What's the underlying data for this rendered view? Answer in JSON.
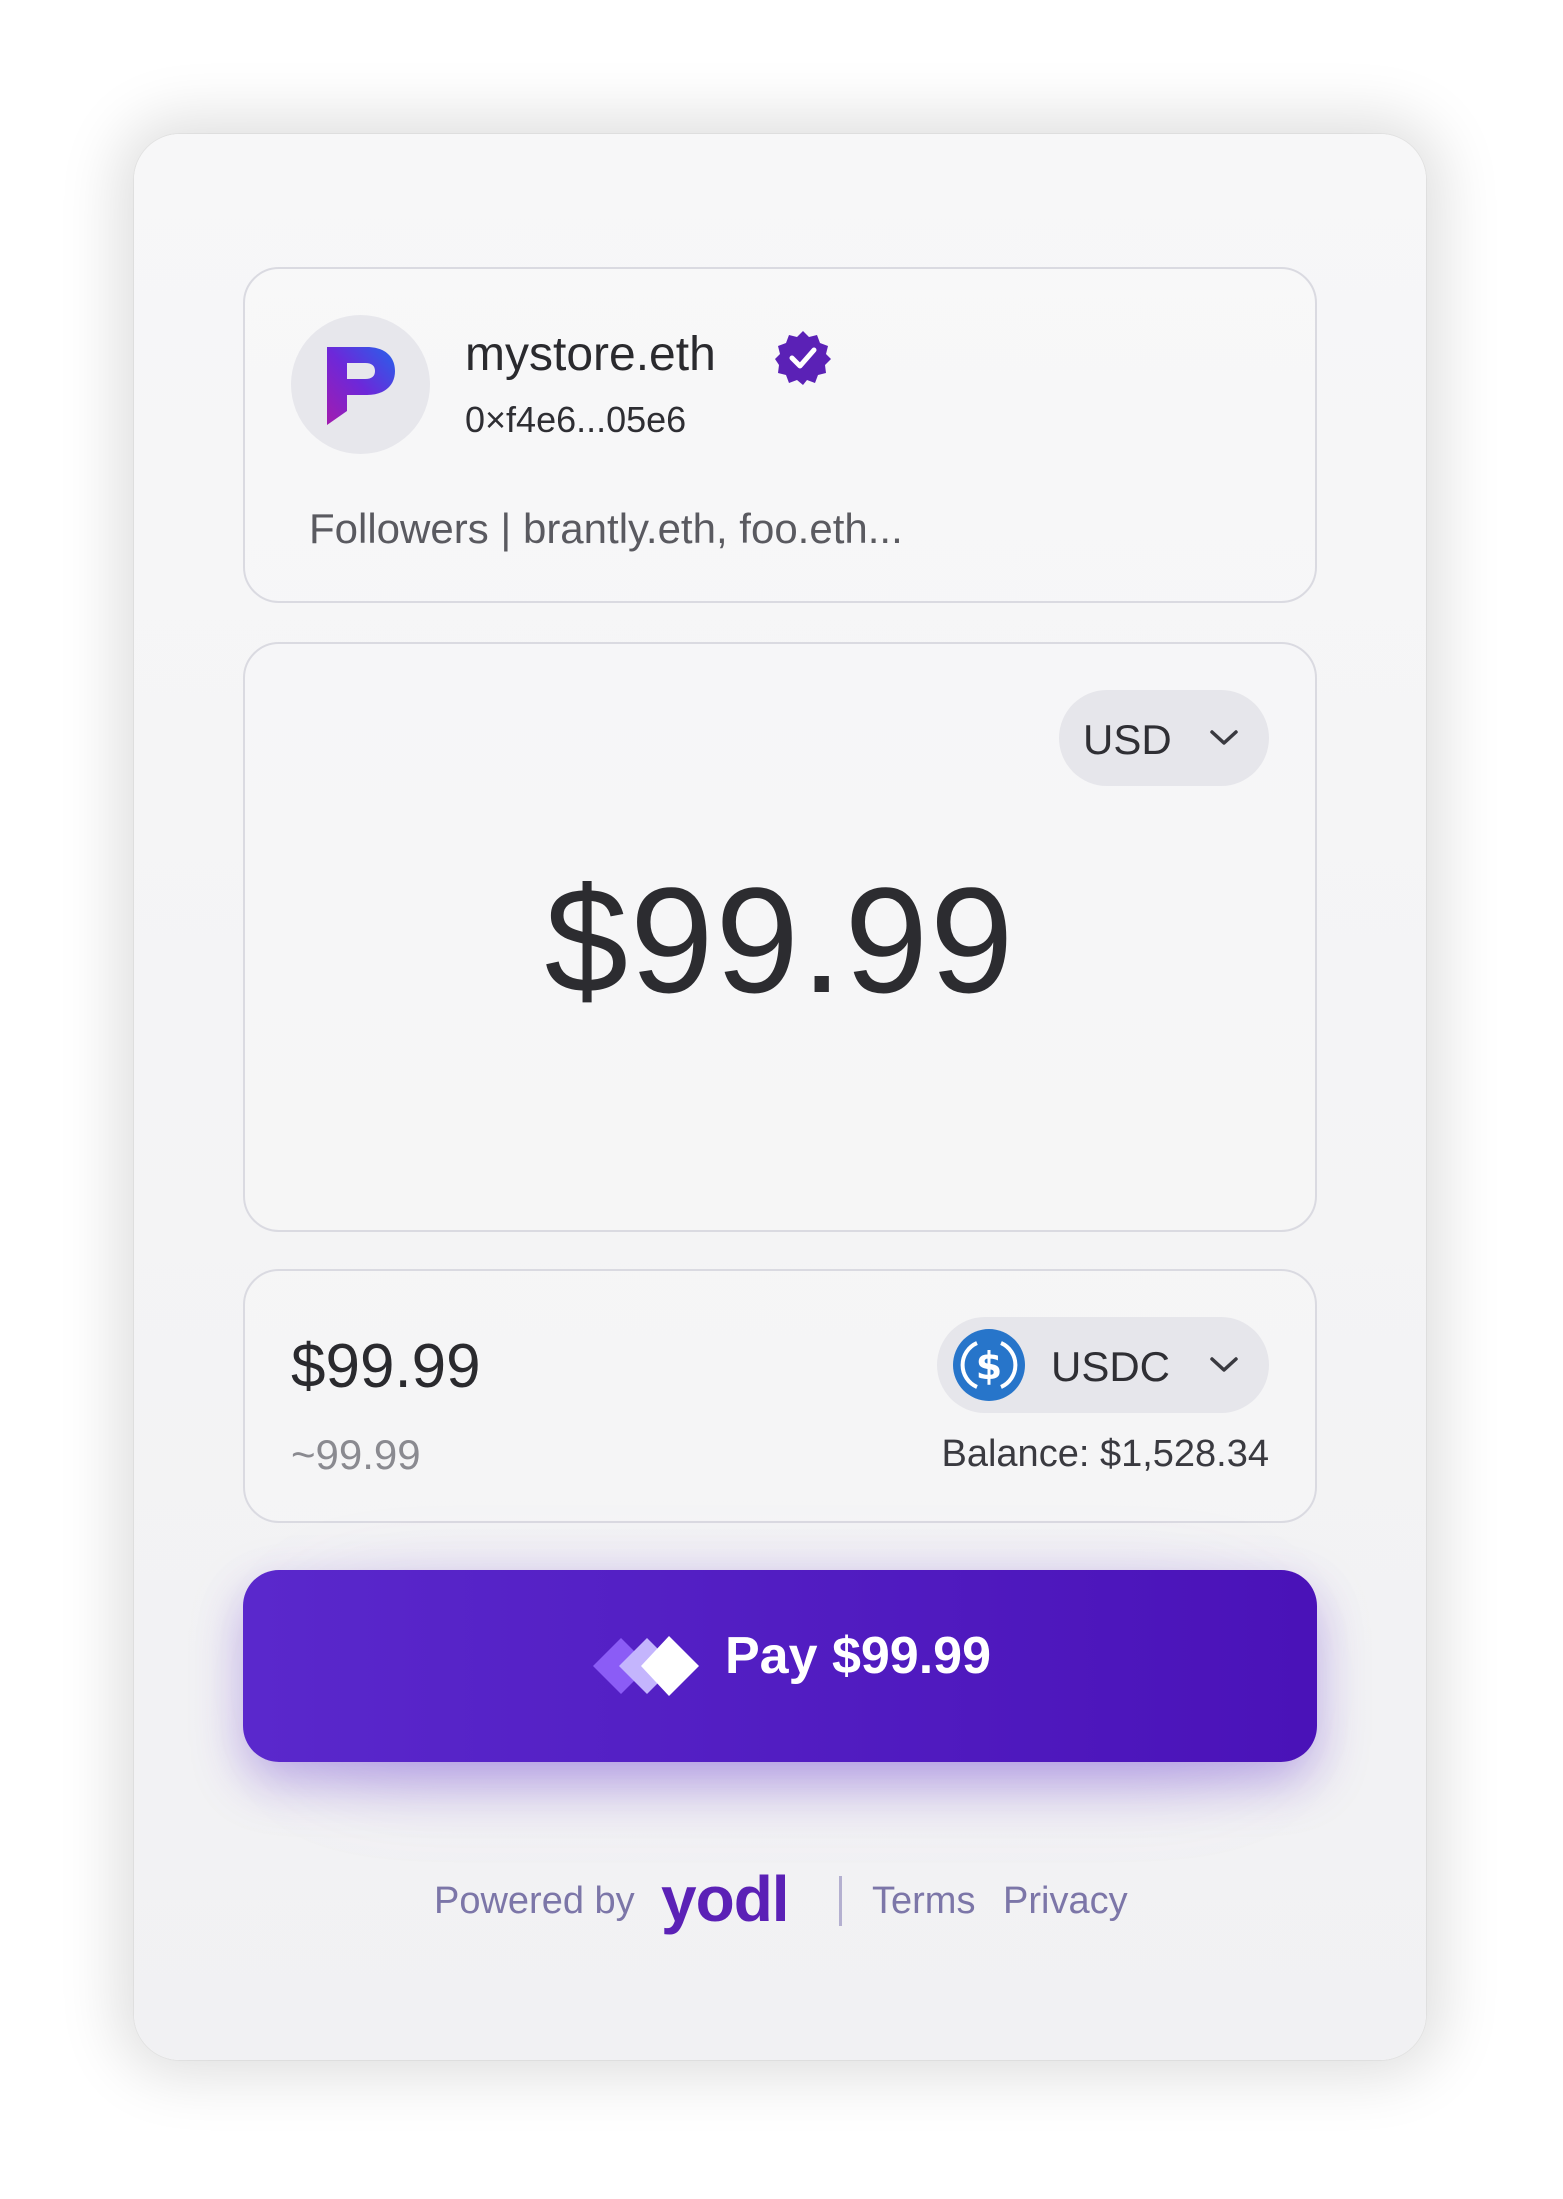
{
  "merchant": {
    "name": "mystore.eth",
    "address": "0×f4e6...05e6",
    "followers": "Followers | brantly.eth, foo.eth..."
  },
  "amount": {
    "currency": "USD",
    "value": "$99.99"
  },
  "token": {
    "amount": "$99.99",
    "approx": "~99.99",
    "symbol": "USDC",
    "balance": "Balance: $1,528.34"
  },
  "pay_button": {
    "label": "Pay $99.99"
  },
  "footer": {
    "powered_by": "Powered by",
    "brand": "yodl",
    "terms": "Terms",
    "privacy": "Privacy"
  },
  "colors": {
    "accent": "#5a28cc",
    "verified": "#5b21b6",
    "usdc": "#2775ca"
  }
}
